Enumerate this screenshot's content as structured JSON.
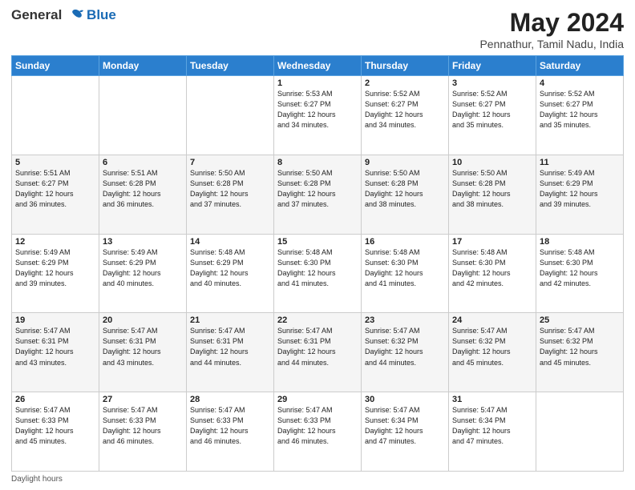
{
  "header": {
    "logo_general": "General",
    "logo_blue": "Blue",
    "title": "May 2024",
    "subtitle": "Pennathur, Tamil Nadu, India"
  },
  "footer": {
    "daylight_label": "Daylight hours"
  },
  "columns": [
    "Sunday",
    "Monday",
    "Tuesday",
    "Wednesday",
    "Thursday",
    "Friday",
    "Saturday"
  ],
  "weeks": [
    {
      "days": [
        {
          "num": "",
          "info": ""
        },
        {
          "num": "",
          "info": ""
        },
        {
          "num": "",
          "info": ""
        },
        {
          "num": "1",
          "info": "Sunrise: 5:53 AM\nSunset: 6:27 PM\nDaylight: 12 hours\nand 34 minutes."
        },
        {
          "num": "2",
          "info": "Sunrise: 5:52 AM\nSunset: 6:27 PM\nDaylight: 12 hours\nand 34 minutes."
        },
        {
          "num": "3",
          "info": "Sunrise: 5:52 AM\nSunset: 6:27 PM\nDaylight: 12 hours\nand 35 minutes."
        },
        {
          "num": "4",
          "info": "Sunrise: 5:52 AM\nSunset: 6:27 PM\nDaylight: 12 hours\nand 35 minutes."
        }
      ]
    },
    {
      "days": [
        {
          "num": "5",
          "info": "Sunrise: 5:51 AM\nSunset: 6:27 PM\nDaylight: 12 hours\nand 36 minutes."
        },
        {
          "num": "6",
          "info": "Sunrise: 5:51 AM\nSunset: 6:28 PM\nDaylight: 12 hours\nand 36 minutes."
        },
        {
          "num": "7",
          "info": "Sunrise: 5:50 AM\nSunset: 6:28 PM\nDaylight: 12 hours\nand 37 minutes."
        },
        {
          "num": "8",
          "info": "Sunrise: 5:50 AM\nSunset: 6:28 PM\nDaylight: 12 hours\nand 37 minutes."
        },
        {
          "num": "9",
          "info": "Sunrise: 5:50 AM\nSunset: 6:28 PM\nDaylight: 12 hours\nand 38 minutes."
        },
        {
          "num": "10",
          "info": "Sunrise: 5:50 AM\nSunset: 6:28 PM\nDaylight: 12 hours\nand 38 minutes."
        },
        {
          "num": "11",
          "info": "Sunrise: 5:49 AM\nSunset: 6:29 PM\nDaylight: 12 hours\nand 39 minutes."
        }
      ]
    },
    {
      "days": [
        {
          "num": "12",
          "info": "Sunrise: 5:49 AM\nSunset: 6:29 PM\nDaylight: 12 hours\nand 39 minutes."
        },
        {
          "num": "13",
          "info": "Sunrise: 5:49 AM\nSunset: 6:29 PM\nDaylight: 12 hours\nand 40 minutes."
        },
        {
          "num": "14",
          "info": "Sunrise: 5:48 AM\nSunset: 6:29 PM\nDaylight: 12 hours\nand 40 minutes."
        },
        {
          "num": "15",
          "info": "Sunrise: 5:48 AM\nSunset: 6:30 PM\nDaylight: 12 hours\nand 41 minutes."
        },
        {
          "num": "16",
          "info": "Sunrise: 5:48 AM\nSunset: 6:30 PM\nDaylight: 12 hours\nand 41 minutes."
        },
        {
          "num": "17",
          "info": "Sunrise: 5:48 AM\nSunset: 6:30 PM\nDaylight: 12 hours\nand 42 minutes."
        },
        {
          "num": "18",
          "info": "Sunrise: 5:48 AM\nSunset: 6:30 PM\nDaylight: 12 hours\nand 42 minutes."
        }
      ]
    },
    {
      "days": [
        {
          "num": "19",
          "info": "Sunrise: 5:47 AM\nSunset: 6:31 PM\nDaylight: 12 hours\nand 43 minutes."
        },
        {
          "num": "20",
          "info": "Sunrise: 5:47 AM\nSunset: 6:31 PM\nDaylight: 12 hours\nand 43 minutes."
        },
        {
          "num": "21",
          "info": "Sunrise: 5:47 AM\nSunset: 6:31 PM\nDaylight: 12 hours\nand 44 minutes."
        },
        {
          "num": "22",
          "info": "Sunrise: 5:47 AM\nSunset: 6:31 PM\nDaylight: 12 hours\nand 44 minutes."
        },
        {
          "num": "23",
          "info": "Sunrise: 5:47 AM\nSunset: 6:32 PM\nDaylight: 12 hours\nand 44 minutes."
        },
        {
          "num": "24",
          "info": "Sunrise: 5:47 AM\nSunset: 6:32 PM\nDaylight: 12 hours\nand 45 minutes."
        },
        {
          "num": "25",
          "info": "Sunrise: 5:47 AM\nSunset: 6:32 PM\nDaylight: 12 hours\nand 45 minutes."
        }
      ]
    },
    {
      "days": [
        {
          "num": "26",
          "info": "Sunrise: 5:47 AM\nSunset: 6:33 PM\nDaylight: 12 hours\nand 45 minutes."
        },
        {
          "num": "27",
          "info": "Sunrise: 5:47 AM\nSunset: 6:33 PM\nDaylight: 12 hours\nand 46 minutes."
        },
        {
          "num": "28",
          "info": "Sunrise: 5:47 AM\nSunset: 6:33 PM\nDaylight: 12 hours\nand 46 minutes."
        },
        {
          "num": "29",
          "info": "Sunrise: 5:47 AM\nSunset: 6:33 PM\nDaylight: 12 hours\nand 46 minutes."
        },
        {
          "num": "30",
          "info": "Sunrise: 5:47 AM\nSunset: 6:34 PM\nDaylight: 12 hours\nand 47 minutes."
        },
        {
          "num": "31",
          "info": "Sunrise: 5:47 AM\nSunset: 6:34 PM\nDaylight: 12 hours\nand 47 minutes."
        },
        {
          "num": "",
          "info": ""
        }
      ]
    }
  ]
}
